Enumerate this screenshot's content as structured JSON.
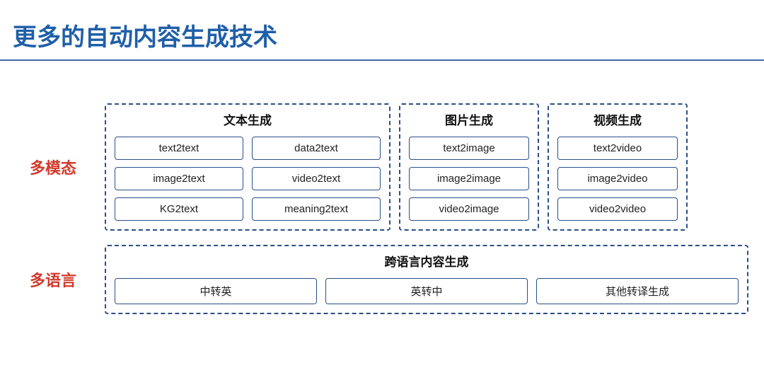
{
  "title": "更多的自动内容生成技术",
  "rows": {
    "multimodal": {
      "label": "多模态",
      "groups": {
        "text": {
          "title": "文本生成",
          "items": [
            [
              "text2text",
              "data2text"
            ],
            [
              "image2text",
              "video2text"
            ],
            [
              "KG2text",
              "meaning2text"
            ]
          ]
        },
        "image": {
          "title": "图片生成",
          "items": [
            "text2image",
            "image2image",
            "video2image"
          ]
        },
        "video": {
          "title": "视频生成",
          "items": [
            "text2video",
            "image2video",
            "video2video"
          ]
        }
      }
    },
    "multilingual": {
      "label": "多语言",
      "group": {
        "title": "跨语言内容生成",
        "items": [
          "中转英",
          "英转中",
          "其他转译生成"
        ]
      }
    }
  }
}
